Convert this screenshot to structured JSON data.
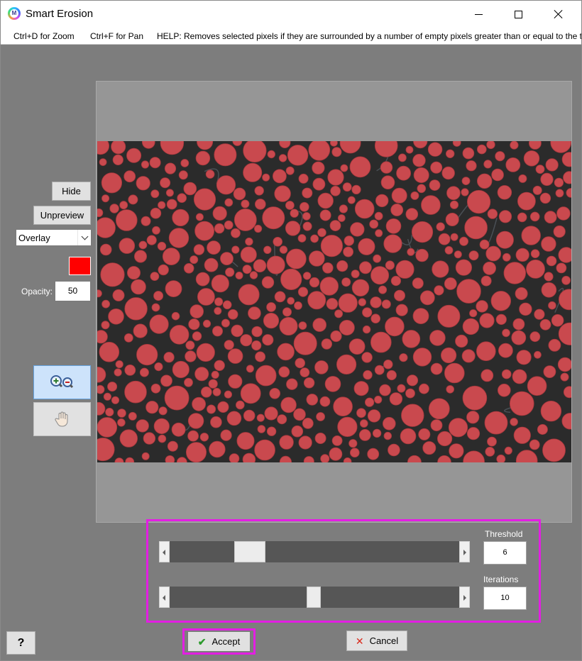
{
  "window": {
    "title": "Smart Erosion"
  },
  "menu": {
    "zoom_hint": "Ctrl+D for Zoom",
    "pan_hint": "Ctrl+F for Pan",
    "help_text": "HELP:  Removes selected pixels if they are surrounded by a number of empty pixels greater than or equal to the threshold"
  },
  "sidebar": {
    "hide_label": "Hide",
    "unpreview_label": "Unpreview",
    "view_mode": {
      "selected": "Overlay"
    },
    "overlay_color": "#ff0000",
    "opacity_label": "Opacity:",
    "opacity_value": "50",
    "tools": {
      "zoom_icon": "zoom-in-out-icon",
      "pan_icon": "hand-pan-icon"
    }
  },
  "image": {
    "description_icon": "segmented-particles-overlay",
    "background_color": "#2b2b2b",
    "particle_color": "#c9494e"
  },
  "params": {
    "threshold": {
      "label": "Threshold",
      "value": "6",
      "slider_fraction": 0.28
    },
    "iterations": {
      "label": "Iterations",
      "value": "10",
      "slider_fraction": 0.5
    }
  },
  "actions": {
    "accept_label": "Accept",
    "cancel_label": "Cancel",
    "help_label": "?"
  },
  "colors": {
    "highlight": "#e31ee3",
    "panel": "#7d7d7d"
  }
}
